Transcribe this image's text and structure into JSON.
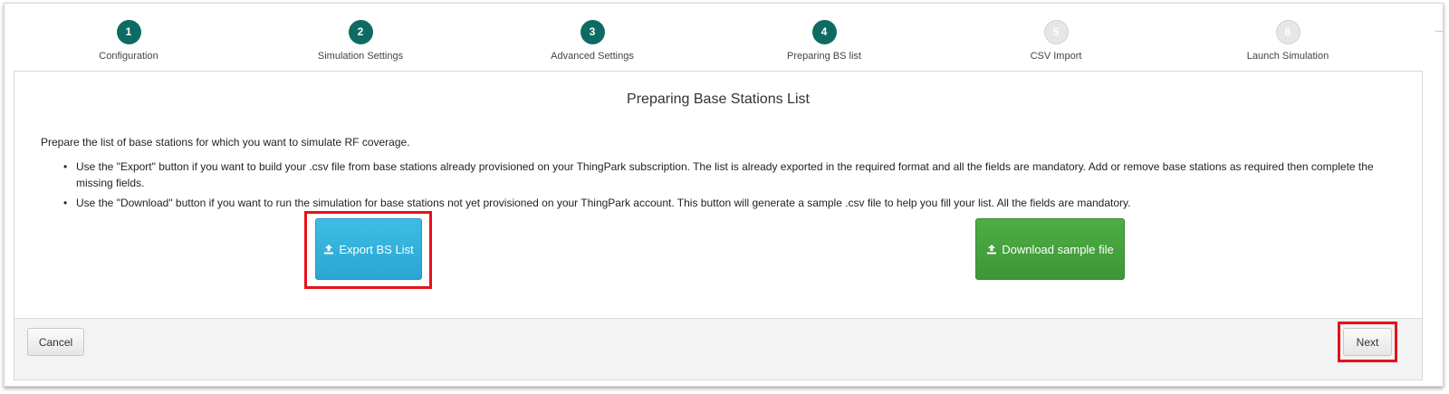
{
  "wizard": {
    "steps": [
      {
        "number": "1",
        "label": "Configuration",
        "state": "done"
      },
      {
        "number": "2",
        "label": "Simulation Settings",
        "state": "done"
      },
      {
        "number": "3",
        "label": "Advanced Settings",
        "state": "done"
      },
      {
        "number": "4",
        "label": "Preparing BS list",
        "state": "current"
      },
      {
        "number": "5",
        "label": "CSV Import",
        "state": "todo"
      },
      {
        "number": "6",
        "label": "Launch Simulation",
        "state": "todo"
      }
    ]
  },
  "panel": {
    "title": "Preparing Base Stations List",
    "intro": "Prepare the list of base stations for which you want to simulate RF coverage.",
    "bullets": [
      "Use the \"Export\" button if you want to build your .csv file from base stations already provisioned on your ThingPark subscription. The list is already exported in the required format and all the fields are mandatory. Add or remove base stations as required then complete the missing fields.",
      "Use the \"Download\" button if you want to run the simulation for base stations not yet provisioned on your ThingPark account. This button will generate a sample .csv file to help you fill your list. All the fields are mandatory."
    ],
    "export_button": {
      "label": "Export BS List",
      "icon": "upload-icon"
    },
    "download_button": {
      "label": "Download sample file",
      "icon": "upload-icon"
    }
  },
  "footer": {
    "cancel_label": "Cancel",
    "next_label": "Next"
  },
  "colors": {
    "step_done": "#0e6b63",
    "step_todo": "#e6e6e6",
    "export_button": "#2aa6d2",
    "download_button": "#3d9637",
    "highlight": "#e8101a"
  }
}
